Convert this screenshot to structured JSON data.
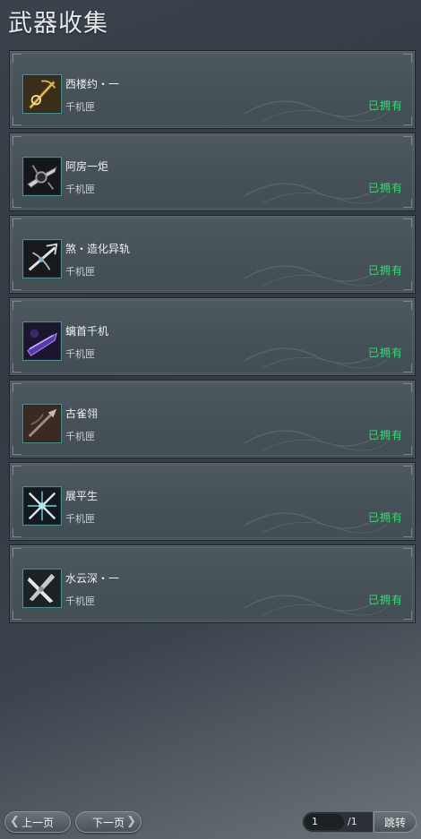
{
  "page": {
    "title": "武器收集"
  },
  "weapons": [
    {
      "name": "西楼约・一",
      "category": "千机匣",
      "status": "已拥有",
      "icon": "gold-sword-icon"
    },
    {
      "name": "阿房一炬",
      "category": "千机匣",
      "status": "已拥有",
      "icon": "dark-blade-icon"
    },
    {
      "name": "煞・造化异轨",
      "category": "千机匣",
      "status": "已拥有",
      "icon": "crossbow-icon"
    },
    {
      "name": "螭首千机",
      "category": "千机匣",
      "status": "已拥有",
      "icon": "purple-blade-icon"
    },
    {
      "name": "古雀翎",
      "category": "千机匣",
      "status": "已拥有",
      "icon": "spear-icon"
    },
    {
      "name": "展平生",
      "category": "千机匣",
      "status": "已拥有",
      "icon": "crossed-blades-icon"
    },
    {
      "name": "水云深・一",
      "category": "千机匣",
      "status": "已拥有",
      "icon": "silver-cross-icon"
    }
  ],
  "pagination": {
    "prev_label": "上一页",
    "next_label": "下一页",
    "current_page": "1",
    "total_pages": "/1",
    "jump_label": "跳转"
  },
  "colors": {
    "owned": "#3fd27a",
    "icon_border": "#4e8d8f"
  }
}
